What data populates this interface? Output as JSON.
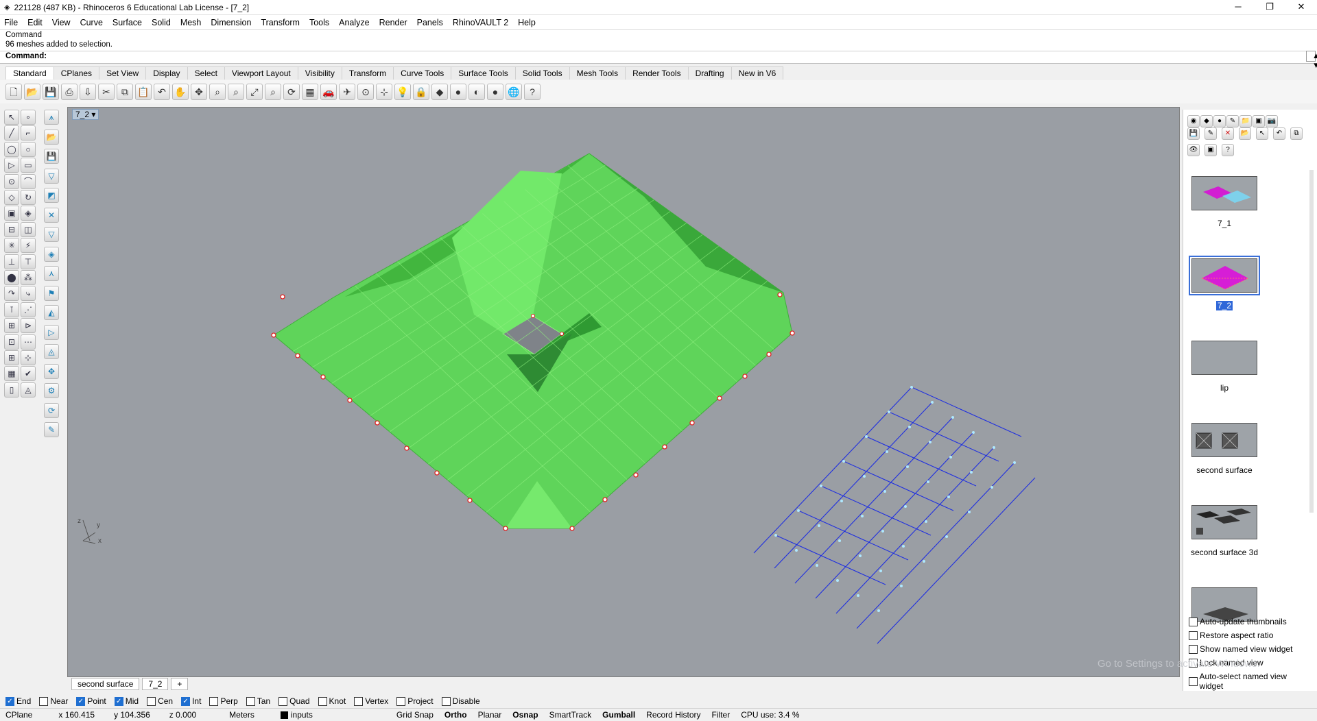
{
  "window": {
    "title": "221128 (487 KB) - Rhinoceros 6 Educational Lab License - [7_2]",
    "minimize": "─",
    "maximize": "❐",
    "close": "✕"
  },
  "menu": [
    "File",
    "Edit",
    "View",
    "Curve",
    "Surface",
    "Solid",
    "Mesh",
    "Dimension",
    "Transform",
    "Tools",
    "Analyze",
    "Render",
    "Panels",
    "RhinoVAULT 2",
    "Help"
  ],
  "command": {
    "history_line1": "Command",
    "history_line2": "96 meshes added to selection.",
    "prompt": "Command:"
  },
  "tabs": [
    "Standard",
    "CPlanes",
    "Set View",
    "Display",
    "Select",
    "Viewport Layout",
    "Visibility",
    "Transform",
    "Curve Tools",
    "Surface Tools",
    "Solid Tools",
    "Mesh Tools",
    "Render Tools",
    "Drafting",
    "New in V6"
  ],
  "toolbar_icons": [
    "new-icon",
    "open-icon",
    "save-icon",
    "print-icon",
    "import-icon",
    "cut-icon",
    "copy-icon",
    "paste-icon",
    "undo-icon",
    "pan-icon",
    "rotate-icon",
    "zoom-icon",
    "zoom-window-icon",
    "zoom-extents-icon",
    "zoom-selected-icon",
    "rotate-view-icon",
    "four-view-icon",
    "car-icon",
    "airplane-icon",
    "cplane-icon",
    "snap-icon",
    "light-icon",
    "lock-icon",
    "material-icon",
    "color-icon",
    "shade-icon",
    "render-sphere-icon",
    "globe-icon",
    "help-icon"
  ],
  "viewport": {
    "name": "7_2",
    "axis_x": "x",
    "axis_y": "y",
    "axis_z": "z"
  },
  "sheets": [
    "second surface",
    "7_2",
    "+"
  ],
  "osnap": [
    {
      "label": "End",
      "checked": true
    },
    {
      "label": "Near",
      "checked": false
    },
    {
      "label": "Point",
      "checked": true
    },
    {
      "label": "Mid",
      "checked": true
    },
    {
      "label": "Cen",
      "checked": false
    },
    {
      "label": "Int",
      "checked": true
    },
    {
      "label": "Perp",
      "checked": false
    },
    {
      "label": "Tan",
      "checked": false
    },
    {
      "label": "Quad",
      "checked": false
    },
    {
      "label": "Knot",
      "checked": false
    },
    {
      "label": "Vertex",
      "checked": false
    },
    {
      "label": "Project",
      "checked": false
    },
    {
      "label": "Disable",
      "checked": false
    }
  ],
  "status": {
    "cplane": "CPlane",
    "x": "x 160.415",
    "y": "y 104.356",
    "z": "z 0.000",
    "units": "Meters",
    "layer": "inputs",
    "grid_snap": "Grid Snap",
    "ortho": "Ortho",
    "planar": "Planar",
    "osnap": "Osnap",
    "smarttrack": "SmartTrack",
    "gumball": "Gumball",
    "record_history": "Record History",
    "filter": "Filter",
    "cpu": "CPU use: 3.4 %"
  },
  "named_views": [
    {
      "label": "7_1"
    },
    {
      "label": "7_2"
    },
    {
      "label": "lip"
    },
    {
      "label": "second surface"
    },
    {
      "label": "second surface 3d"
    },
    {
      "label": ""
    }
  ],
  "panel_options": [
    {
      "label": "Auto-update thumbnails",
      "checked": false
    },
    {
      "label": "Restore aspect ratio",
      "checked": false
    },
    {
      "label": "Show named view widget",
      "checked": false
    },
    {
      "label": "Lock named view",
      "checked": false
    },
    {
      "label": "Auto-select named view widget",
      "checked": false
    }
  ],
  "watermark": "Go to Settings to activate Windows.",
  "colors": {
    "mesh_fill": "#5fd45a",
    "mesh_edge": "#8ef07f",
    "viewport_bg": "#9a9ea4",
    "grid_line": "#1f2fe0",
    "accent": "#1f6fd1"
  }
}
